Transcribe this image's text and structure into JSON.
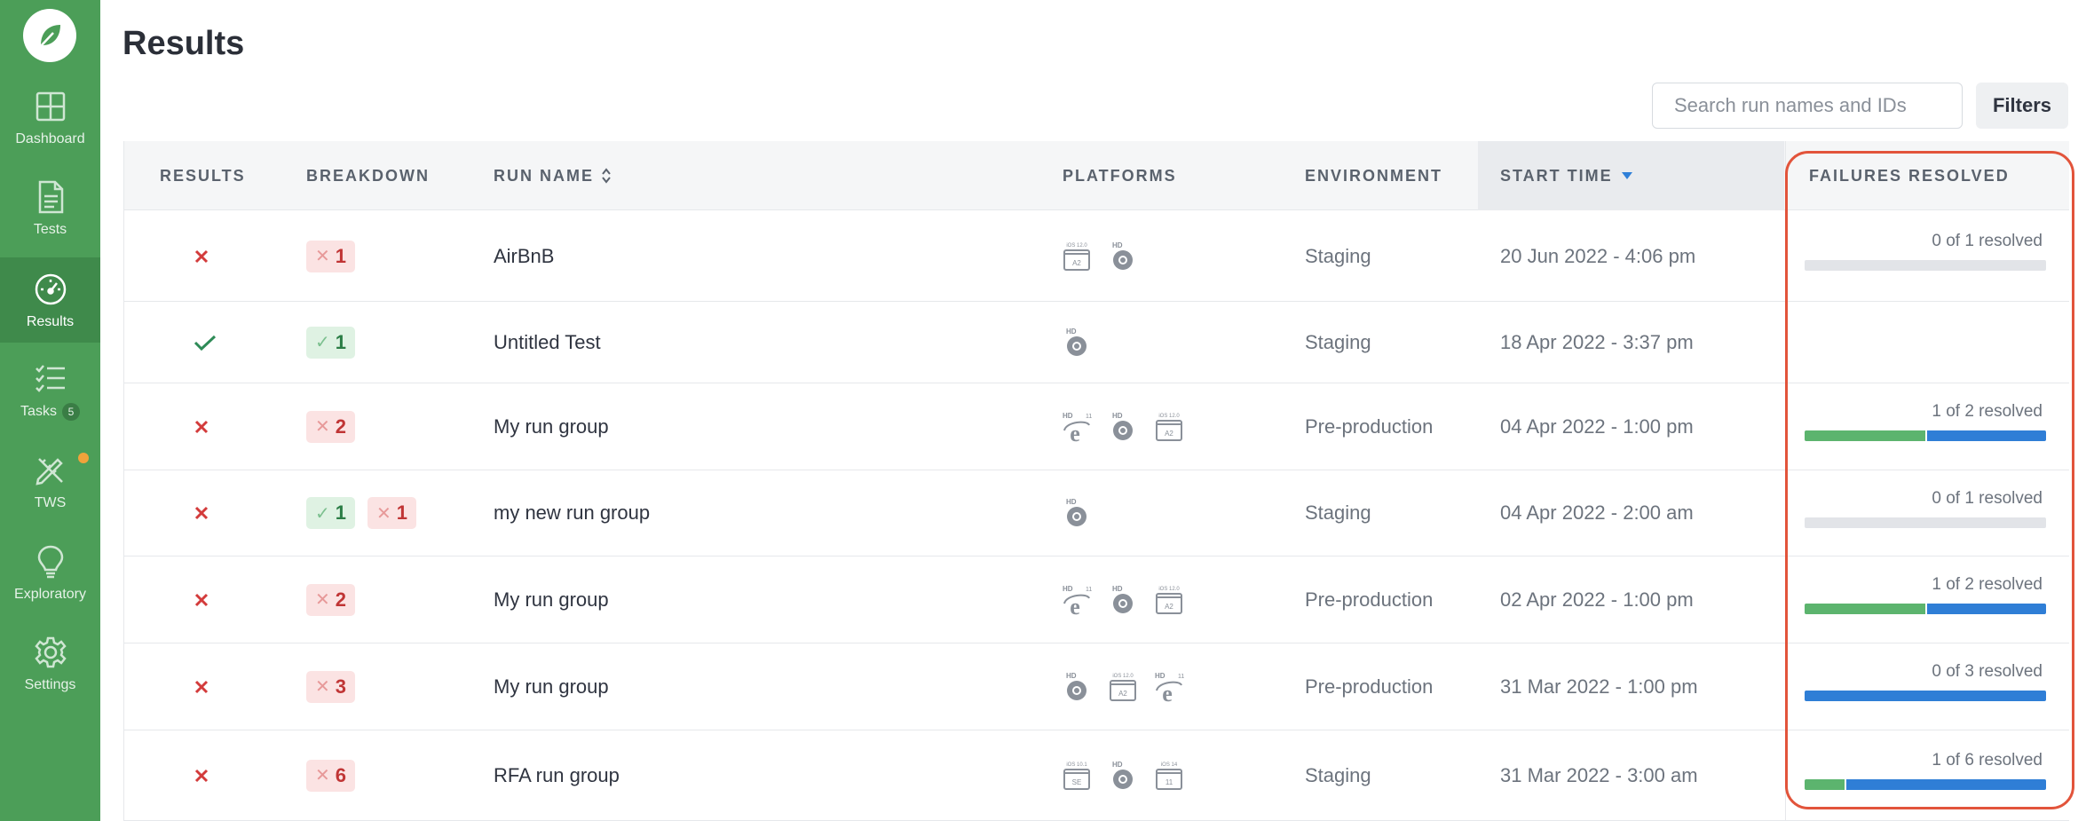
{
  "sidebar": {
    "items": [
      {
        "label": "Dashboard",
        "icon": "dashboard-grid-icon"
      },
      {
        "label": "Tests",
        "icon": "document-icon"
      },
      {
        "label": "Results",
        "icon": "speedometer-icon"
      },
      {
        "label": "Tasks",
        "icon": "checklist-icon",
        "count": "5"
      },
      {
        "label": "TWS",
        "icon": "pencil-ruler-icon"
      },
      {
        "label": "Exploratory",
        "icon": "lightbulb-icon"
      },
      {
        "label": "Settings",
        "icon": "gear-icon"
      }
    ]
  },
  "header": {
    "title": "Results"
  },
  "search": {
    "placeholder": "Search run names and IDs"
  },
  "filters_label": "Filters",
  "columns": {
    "results": "RESULTS",
    "breakdown": "BREAKDOWN",
    "run_name": "RUN NAME",
    "platforms": "PLATFORMS",
    "environment": "ENVIRONMENT",
    "start_time": "START TIME",
    "failures_resolved": "FAILURES RESOLVED"
  },
  "rows": [
    {
      "status": "fail",
      "breakdown": [
        {
          "type": "fail",
          "count": "1"
        }
      ],
      "name": "AirBnB",
      "platforms": [
        "ios-12-a2",
        "chrome-hd"
      ],
      "environment": "Staging",
      "start": "20 Jun 2022 - 4:06 pm",
      "resolved_text": "0 of 1 resolved",
      "resolved": 0,
      "unresolved": 0
    },
    {
      "status": "pass",
      "breakdown": [
        {
          "type": "pass",
          "count": "1"
        }
      ],
      "name": "Untitled Test",
      "platforms": [
        "chrome-hd"
      ],
      "environment": "Staging",
      "start": "18 Apr 2022 - 3:37 pm",
      "resolved_text": "",
      "resolved": 0,
      "unresolved": 0
    },
    {
      "status": "fail",
      "breakdown": [
        {
          "type": "fail",
          "count": "2"
        }
      ],
      "name": "My run group",
      "platforms": [
        "ie-11-hd",
        "chrome-hd",
        "ios-12-a2"
      ],
      "environment": "Pre-production",
      "start": "04 Apr 2022 - 1:00 pm",
      "resolved_text": "1 of 2 resolved",
      "resolved": 0.5,
      "unresolved": 0.5
    },
    {
      "status": "fail",
      "breakdown": [
        {
          "type": "pass",
          "count": "1"
        },
        {
          "type": "fail",
          "count": "1"
        }
      ],
      "name": "my new run group",
      "platforms": [
        "chrome-hd"
      ],
      "environment": "Staging",
      "start": "04 Apr 2022 - 2:00 am",
      "resolved_text": "0 of 1 resolved",
      "resolved": 0,
      "unresolved": 0
    },
    {
      "status": "fail",
      "breakdown": [
        {
          "type": "fail",
          "count": "2"
        }
      ],
      "name": "My run group",
      "platforms": [
        "ie-11-hd",
        "chrome-hd",
        "ios-12-a2"
      ],
      "environment": "Pre-production",
      "start": "02 Apr 2022 - 1:00 pm",
      "resolved_text": "1 of 2 resolved",
      "resolved": 0.5,
      "unresolved": 0.5
    },
    {
      "status": "fail",
      "breakdown": [
        {
          "type": "fail",
          "count": "3"
        }
      ],
      "name": "My run group",
      "platforms": [
        "chrome-hd",
        "ios-12-a2",
        "ie-11-hd"
      ],
      "environment": "Pre-production",
      "start": "31 Mar 2022 - 1:00 pm",
      "resolved_text": "0 of 3 resolved",
      "resolved": 0,
      "unresolved": 1
    },
    {
      "status": "fail",
      "breakdown": [
        {
          "type": "fail",
          "count": "6"
        }
      ],
      "name": "RFA run group",
      "platforms": [
        "ios-10-se",
        "chrome-hd",
        "ios-14-11"
      ],
      "environment": "Staging",
      "start": "31 Mar 2022 - 3:00 am",
      "resolved_text": "1 of 6 resolved",
      "resolved": 0.167,
      "unresolved": 0.833
    }
  ],
  "platform_labels": {
    "ios-12-a2": {
      "top": "iOS 12.0",
      "box": "A2"
    },
    "ios-10-se": {
      "top": "iOS 10.1",
      "box": "SE"
    },
    "ios-14-11": {
      "top": "iOS 14",
      "box": "11"
    },
    "chrome-hd": {
      "top": "HD"
    },
    "ie-11-hd": {
      "top": "HD",
      "sup": "11"
    }
  },
  "colors": {
    "sidebar": "#4c9e58",
    "fail": "#d33b3b",
    "pass": "#2e8b57",
    "resolved_bar": "#5cb46e",
    "unresolved_bar": "#2f7ed6",
    "highlight": "#e2543b"
  }
}
